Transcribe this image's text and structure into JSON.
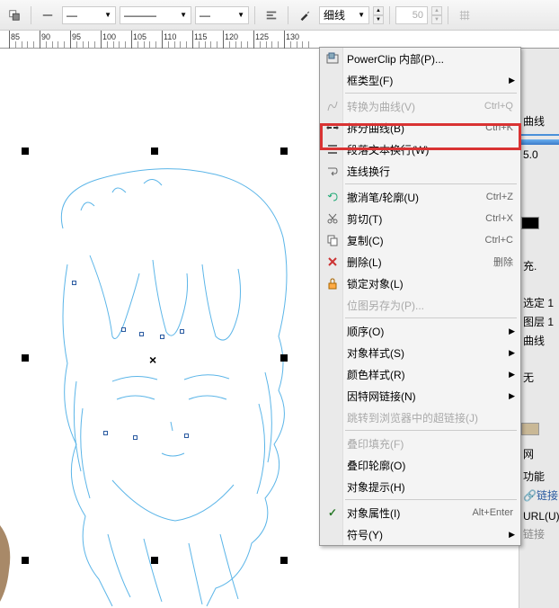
{
  "toolbar": {
    "stroke_style_label": "细线",
    "opacity_value": "50",
    "opacity_suffix": ""
  },
  "ruler": {
    "ticks": [
      {
        "pos": 10,
        "label": "85"
      },
      {
        "pos": 44,
        "label": "90"
      },
      {
        "pos": 78,
        "label": "95"
      },
      {
        "pos": 112,
        "label": "100"
      },
      {
        "pos": 146,
        "label": "105"
      },
      {
        "pos": 180,
        "label": "110"
      },
      {
        "pos": 214,
        "label": "115"
      },
      {
        "pos": 248,
        "label": "120"
      },
      {
        "pos": 282,
        "label": "125"
      },
      {
        "pos": 316,
        "label": "130"
      }
    ]
  },
  "menu": {
    "items": [
      {
        "id": "powerclip",
        "label": "PowerClip 内部(P)...",
        "icon": "powerclip-icon",
        "enabled": true
      },
      {
        "id": "frametype",
        "label": "框类型(F)",
        "enabled": true,
        "submenu": true
      },
      {
        "sep": true
      },
      {
        "id": "tocurves",
        "label": "转换为曲线(V)",
        "shortcut": "Ctrl+Q",
        "icon": "curves-icon",
        "enabled": false
      },
      {
        "id": "breakapart",
        "label": "拆分曲线(B)",
        "shortcut": "Ctrl+K",
        "icon": "break-icon",
        "enabled": true
      },
      {
        "id": "paratext",
        "label": "段落文本换行(W)",
        "icon": "paratext-icon",
        "enabled": true
      },
      {
        "id": "linewrap",
        "label": "连线换行",
        "icon": "linewrap-icon",
        "enabled": true
      },
      {
        "sep": true
      },
      {
        "id": "undo",
        "label": "撤消笔/轮廓(U)",
        "shortcut": "Ctrl+Z",
        "icon": "undo-icon",
        "enabled": true
      },
      {
        "id": "cut",
        "label": "剪切(T)",
        "shortcut": "Ctrl+X",
        "icon": "cut-icon",
        "enabled": true
      },
      {
        "id": "copy",
        "label": "复制(C)",
        "shortcut": "Ctrl+C",
        "icon": "copy-icon",
        "enabled": true
      },
      {
        "id": "delete",
        "label": "删除(L)",
        "shortcut": "删除",
        "icon": "delete-icon",
        "enabled": true
      },
      {
        "id": "lock",
        "label": "锁定对象(L)",
        "icon": "lock-icon",
        "enabled": true
      },
      {
        "id": "saveas",
        "label": "位图另存为(P)...",
        "enabled": false
      },
      {
        "sep": true
      },
      {
        "id": "order",
        "label": "顺序(O)",
        "enabled": true,
        "submenu": true
      },
      {
        "id": "objstyle",
        "label": "对象样式(S)",
        "enabled": true,
        "submenu": true
      },
      {
        "id": "colorstyle",
        "label": "颜色样式(R)",
        "enabled": true,
        "submenu": true
      },
      {
        "id": "hyperlink",
        "label": "因特网链接(N)",
        "enabled": true,
        "submenu": true
      },
      {
        "id": "jumplink",
        "label": "跳转到浏览器中的超链接(J)",
        "enabled": false
      },
      {
        "sep": true
      },
      {
        "id": "overfill",
        "label": "叠印填充(F)",
        "enabled": false
      },
      {
        "id": "overoutline",
        "label": "叠印轮廓(O)",
        "enabled": true
      },
      {
        "id": "objhint",
        "label": "对象提示(H)",
        "enabled": true
      },
      {
        "sep": true
      },
      {
        "id": "objprop",
        "label": "对象属性(I)",
        "shortcut": "Alt+Enter",
        "icon": "check-icon",
        "enabled": true
      },
      {
        "id": "symbol",
        "label": "符号(Y)",
        "enabled": true,
        "submenu": true
      }
    ]
  },
  "right_panel": {
    "line_label": "曲线",
    "value_50": "5.0",
    "fill_label": "充.",
    "sel_label": "选定 1",
    "layer_label": "图层 1",
    "curve_label": "曲线",
    "none_label": "无",
    "net_label": "网",
    "ability_label": "功能",
    "link_label": "链接",
    "url_label": "URL(U):",
    "link_tail": "链接"
  }
}
